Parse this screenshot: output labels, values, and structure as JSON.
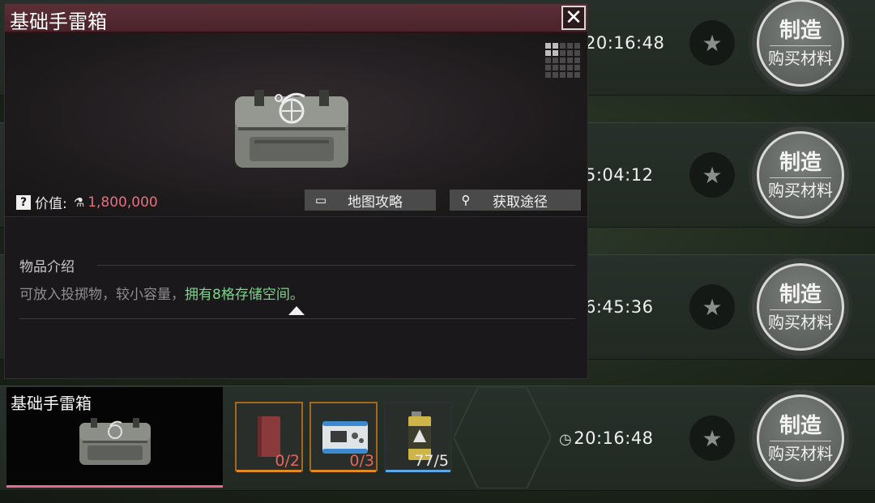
{
  "popup": {
    "title": "基础手雷箱",
    "close_icon": "close-icon",
    "value_label": "价值:",
    "value_amount": "1,800,000",
    "buttons": [
      {
        "label": "地图攻略",
        "icon": "map-guide-icon"
      },
      {
        "label": "获取途径",
        "icon": "search-icon"
      }
    ],
    "description": {
      "title": "物品介绍",
      "text_plain": "可放入投掷物，较小容量，",
      "text_highlight": "拥有8格存储空间。"
    }
  },
  "rows": [
    {
      "time": "20:16:48",
      "craft_label": "制造",
      "buy_label": "购买材料"
    },
    {
      "time": "5:04:12",
      "craft_label": "制造",
      "buy_label": "购买材料"
    },
    {
      "time": "6:45:36",
      "craft_label": "制造",
      "buy_label": "购买材料"
    },
    {
      "time": "20:16:48",
      "craft_label": "制造",
      "buy_label": "购买材料"
    }
  ],
  "bottom_item": {
    "name": "基础手雷箱",
    "materials": [
      {
        "name": "red-book",
        "count": "0/2",
        "status": "insufficient"
      },
      {
        "name": "power-station",
        "count": "0/3",
        "status": "insufficient"
      },
      {
        "name": "oil-can",
        "count": "77/5",
        "status": "sufficient"
      }
    ]
  },
  "colors": {
    "header": "#4a232a",
    "value": "#e5707f",
    "highlight": "#7bd68a",
    "selected_bar": "#e86a8c",
    "orange_rarity": "#e28b25",
    "blue_rarity": "#5aa8e8"
  }
}
